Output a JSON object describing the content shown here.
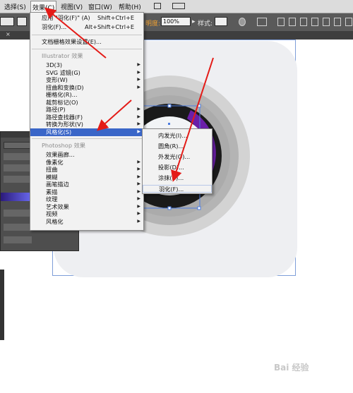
{
  "menubar": {
    "items": [
      "选择(S)",
      "效果(C)",
      "视图(V)",
      "窗口(W)",
      "帮助(H)"
    ]
  },
  "controlbar": {
    "opacity_label": "明度:",
    "opacity_value": "100%",
    "style_label": "样式:"
  },
  "effect_menu": {
    "apply_last": {
      "label": "应用 \"羽化(F)\" (A)",
      "shortcut": "Shift+Ctrl+E"
    },
    "last_effect": {
      "label": "羽化(F)...",
      "shortcut": "Alt+Shift+Ctrl+E"
    },
    "raster_settings": "文档栅格效果设置(E)...",
    "illustrator_header": "Illustrator 效果",
    "illustrator_items": [
      "3D(3)",
      "SVG 滤镜(G)",
      "变形(W)",
      "扭曲和变换(D)",
      "栅格化(R)...",
      "裁剪标记(O)",
      "路径(P)",
      "路径查找器(F)",
      "转换为形状(V)",
      "风格化(S)"
    ],
    "photoshop_header": "Photoshop 效果",
    "photoshop_items": [
      "效果画廊...",
      "像素化",
      "扭曲",
      "模糊",
      "画笔描边",
      "素描",
      "纹理",
      "艺术效果",
      "视频",
      "风格化"
    ]
  },
  "stylize_submenu": {
    "items": [
      "内发光(I)...",
      "圆角(R)...",
      "外发光(O)...",
      "投影(D)...",
      "涂抹(B)...",
      "羽化(F)..."
    ]
  },
  "watermark": "Bai 经验",
  "colors": {
    "menubar_bg": "#dcdcdc",
    "controlbar_bg": "#5a5a5a",
    "highlight": "#3a66c8",
    "arrow_red": "#e41b17",
    "artboard_border": "#7e9ed8",
    "purple": "#6a1fa8"
  }
}
